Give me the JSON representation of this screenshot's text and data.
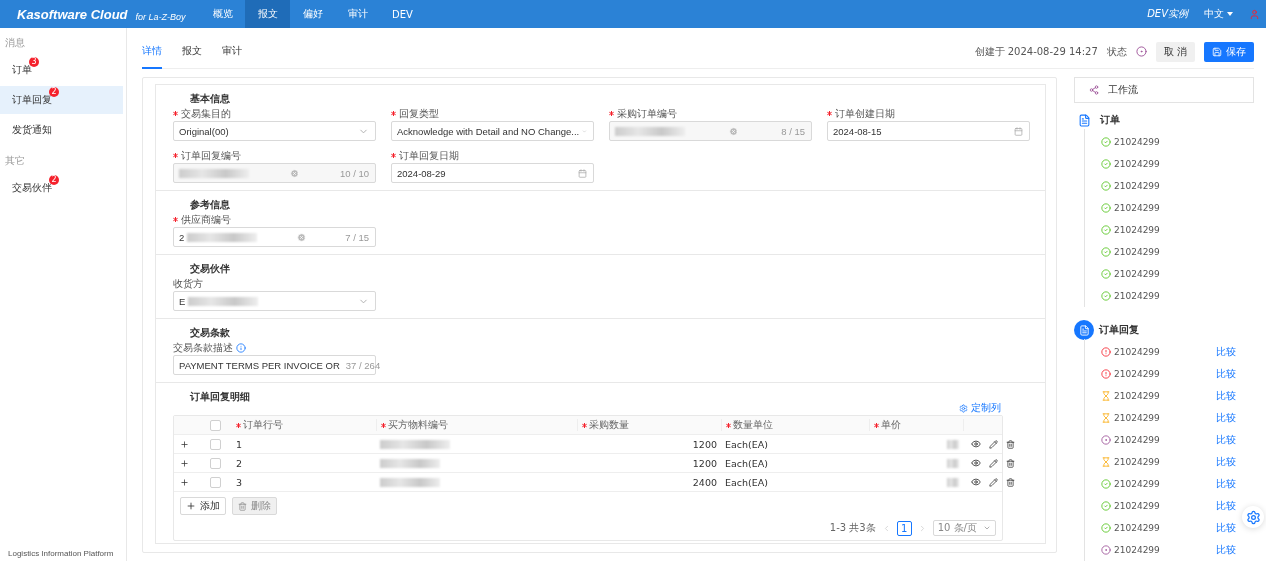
{
  "topbar": {
    "brand": "Kasoftware Cloud",
    "brand_sub": "for La-Z-Boy",
    "nav": [
      {
        "label": "概览",
        "selected": false
      },
      {
        "label": "报文",
        "selected": true
      },
      {
        "label": "偏好",
        "selected": false
      },
      {
        "label": "审计",
        "selected": false
      },
      {
        "label": "DEV",
        "selected": false
      }
    ],
    "instance": "DEV实例",
    "language": "中文"
  },
  "sidebar": {
    "groups": [
      {
        "label": "消息",
        "items": [
          {
            "label": "订单",
            "badge": "3",
            "selected": false
          },
          {
            "label": "订单回复",
            "badge": "2",
            "selected": true
          },
          {
            "label": "发货通知",
            "selected": false
          }
        ]
      },
      {
        "label": "其它",
        "items": [
          {
            "label": "交易伙伴",
            "badge": "2",
            "selected": false
          }
        ]
      }
    ],
    "footer": "Logistics Information Platform"
  },
  "tabs": [
    {
      "label": "详情",
      "selected": true
    },
    {
      "label": "报文",
      "selected": false
    },
    {
      "label": "审计",
      "selected": false
    }
  ],
  "header": {
    "created": "创建于 2024-08-29 14:27",
    "status_label": "状态",
    "cancel": "取 消",
    "save": "保存"
  },
  "sections": [
    {
      "title": "基本信息",
      "fields": [
        {
          "kind": "select",
          "label": "交易集目的",
          "required": true,
          "value": "Original(00)"
        },
        {
          "kind": "select",
          "label": "回复类型",
          "required": true,
          "value": "Acknowledge with Detail and NO Change..."
        },
        {
          "kind": "input",
          "label": "采购订单编号",
          "required": true,
          "redacted": true,
          "counter": "8 / 15"
        },
        {
          "kind": "date",
          "label": "订单创建日期",
          "required": true,
          "value": "2024-08-15"
        },
        {
          "kind": "input",
          "label": "订单回复编号",
          "required": true,
          "redacted": true,
          "counter": "10 / 10"
        },
        {
          "kind": "date",
          "label": "订单回复日期",
          "required": true,
          "value": "2024-08-29"
        }
      ]
    },
    {
      "title": "参考信息",
      "fields": [
        {
          "kind": "input",
          "label": "供应商编号",
          "required": true,
          "value": "2",
          "redacted": true,
          "counter": "7 / 15"
        }
      ]
    },
    {
      "title": "交易伙伴",
      "fields": [
        {
          "kind": "select",
          "label": "收货方",
          "required": false,
          "value": "E",
          "redacted": true
        }
      ]
    },
    {
      "title": "交易条款",
      "fields": [
        {
          "kind": "input",
          "label": "交易条款描述",
          "required": false,
          "info": true,
          "value": "PAYMENT TERMS PER INVOICE OR",
          "counter": "37 / 264"
        }
      ]
    }
  ],
  "table": {
    "title": "订单回复明细",
    "customize": "定制列",
    "columns": [
      {
        "label": "订单行号",
        "required": true
      },
      {
        "label": "买方物料编号",
        "required": true
      },
      {
        "label": "采购数量",
        "required": true
      },
      {
        "label": "数量单位",
        "required": true
      },
      {
        "label": "单价",
        "required": true
      }
    ],
    "all_checked": false,
    "rows": [
      {
        "line": "1",
        "qty": "1200",
        "unit": "Each(EA)",
        "checked": false
      },
      {
        "line": "2",
        "qty": "1200",
        "unit": "Each(EA)",
        "checked": false
      },
      {
        "line": "3",
        "qty": "2400",
        "unit": "Each(EA)",
        "checked": false
      }
    ],
    "add": {
      "label": "添加",
      "disabled": false
    },
    "delete": {
      "label": "删除",
      "disabled": true
    },
    "pagination": {
      "summary": "1-3 共3条",
      "page": "1",
      "page_size": "10 条/页"
    }
  },
  "workflow": {
    "title": "工作流",
    "groups": [
      {
        "title": "订单",
        "items": [
          {
            "id": "21024299",
            "kind": "success"
          },
          {
            "id": "21024299",
            "kind": "success"
          },
          {
            "id": "21024299",
            "kind": "success"
          },
          {
            "id": "21024299",
            "kind": "success"
          },
          {
            "id": "21024299",
            "kind": "success"
          },
          {
            "id": "21024299",
            "kind": "success"
          },
          {
            "id": "21024299",
            "kind": "success"
          },
          {
            "id": "21024299",
            "kind": "success"
          }
        ]
      },
      {
        "title": "订单回复",
        "items": [
          {
            "id": "21024299",
            "kind": "error",
            "compare": "比较"
          },
          {
            "id": "21024299",
            "kind": "error",
            "compare": "比较"
          },
          {
            "id": "21024299",
            "kind": "pending",
            "compare": "比较"
          },
          {
            "id": "21024299",
            "kind": "pending",
            "compare": "比较"
          },
          {
            "id": "21024299",
            "kind": "processing",
            "compare": "比较"
          },
          {
            "id": "21024299",
            "kind": "pending",
            "compare": "比较"
          },
          {
            "id": "21024299",
            "kind": "success",
            "compare": "比较"
          },
          {
            "id": "21024299",
            "kind": "success",
            "compare": "比较"
          },
          {
            "id": "21024299",
            "kind": "success",
            "compare": "比较"
          },
          {
            "id": "21024299",
            "kind": "processing",
            "compare": "比较"
          }
        ]
      }
    ]
  }
}
